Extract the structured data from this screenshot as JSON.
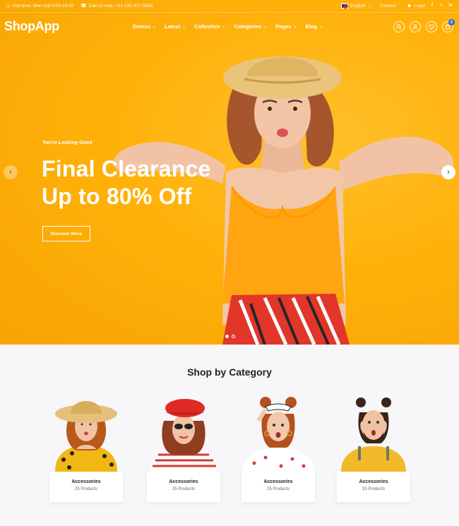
{
  "topbar": {
    "visit_time": "Visit time: Mon-Sat 9:00-19:00",
    "call_us": "Call us now: +01 035-477-5588",
    "language": "English",
    "contact": "Contact",
    "login": "Login"
  },
  "header": {
    "logo": "ShopApp",
    "nav": [
      "Demos",
      "Latest",
      "Collection",
      "Categories",
      "Pages",
      "Blog"
    ],
    "cart_count": "0"
  },
  "hero": {
    "eyebrow": "You're Looking Good",
    "line1": "Final Clearance",
    "line2": "Up to 80% Off",
    "cta": "Discover More",
    "slide_count": 2,
    "active_slide": 1
  },
  "categories": {
    "title": "Shop by Category",
    "items": [
      {
        "name": "Accessories",
        "count": "25 Products"
      },
      {
        "name": "Accessories",
        "count": "25 Products"
      },
      {
        "name": "Accessories",
        "count": "25 Products"
      },
      {
        "name": "Accessories",
        "count": "25 Products"
      }
    ]
  },
  "colors": {
    "hero_bg": "#ffb10a",
    "badge": "#3566e6",
    "section_bg": "#f7f7f9"
  },
  "icons": [
    "clock-icon",
    "phone-icon",
    "flag-uk-icon",
    "user-icon",
    "facebook-icon",
    "twitter-icon",
    "linkedin-icon",
    "search-icon",
    "account-icon",
    "heart-icon",
    "cart-icon",
    "chevron-left-icon",
    "chevron-right-icon"
  ]
}
